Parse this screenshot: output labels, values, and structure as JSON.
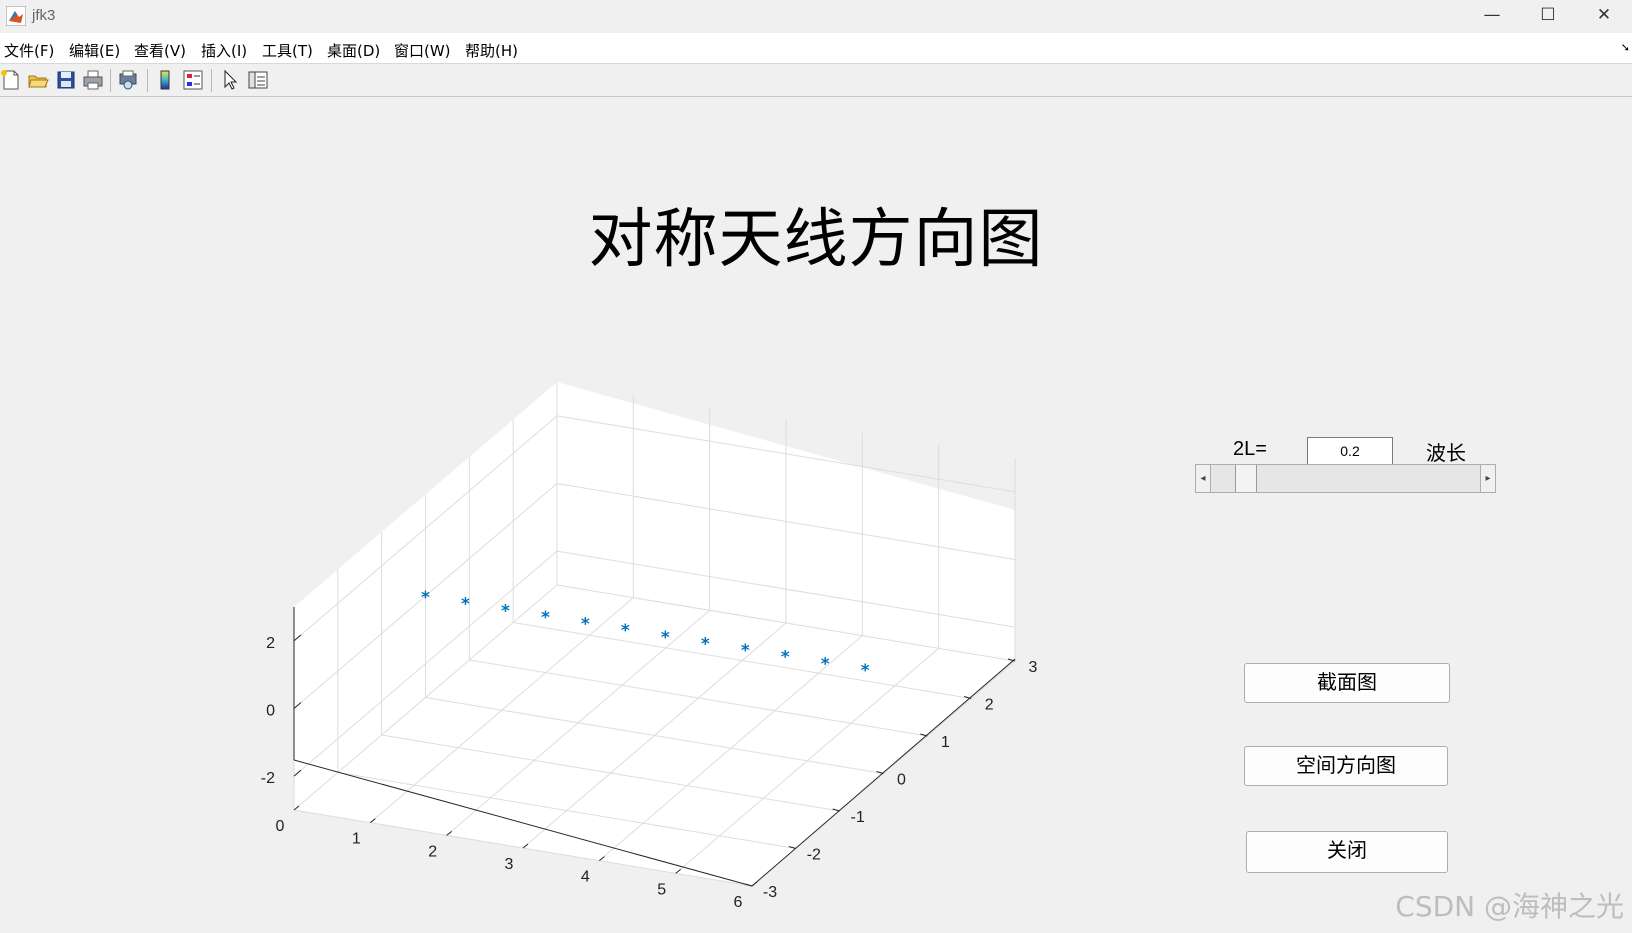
{
  "window": {
    "title": "jfk3",
    "minimize_glyph": "—",
    "maximize_glyph": "☐",
    "close_glyph": "✕"
  },
  "menu": {
    "items": [
      "文件(F)",
      "编辑(E)",
      "查看(V)",
      "插入(I)",
      "工具(T)",
      "桌面(D)",
      "窗口(W)",
      "帮助(H)"
    ]
  },
  "toolbar": {
    "icons": [
      "new-figure-icon",
      "open-file-icon",
      "save-icon",
      "print-icon",
      "print-preview-icon",
      "colorbar-icon",
      "legend-icon",
      "pointer-icon",
      "property-inspector-icon"
    ]
  },
  "figure": {
    "title": "对称天线方向图"
  },
  "controls": {
    "length_label": "2L=",
    "length_value": "0.2",
    "unit_label": "波长",
    "slider_fraction": 0.1,
    "cross_section_button": "截面图",
    "spatial_pattern_button": "空间方向图",
    "close_button": "关闭"
  },
  "watermark": "CSDN @海神之光",
  "chart_data": {
    "type": "scatter",
    "marker": "*",
    "marker_color": "#0072bd",
    "view": "3d",
    "grid": true,
    "xlim": [
      0,
      6
    ],
    "ylim": [
      -3,
      3
    ],
    "zlim": [
      -3,
      3
    ],
    "x_ticks": [
      "0",
      "1",
      "2",
      "3",
      "4",
      "5",
      "6"
    ],
    "y_ticks": [
      "-3",
      "-2",
      "-1",
      "0",
      "1",
      "2",
      "3"
    ],
    "z_ticks": [
      "-2",
      "0",
      "2"
    ],
    "points": {
      "x": [
        0,
        0.524,
        1.047,
        1.571,
        2.094,
        2.618,
        3.142,
        3.665,
        4.189,
        4.712,
        5.236,
        5.76
      ],
      "y": [
        0,
        0,
        0,
        0,
        0,
        0,
        0,
        0,
        0,
        0,
        0,
        0
      ],
      "z": [
        0,
        0,
        0,
        0,
        0,
        0,
        0,
        0,
        0,
        0,
        0,
        0
      ]
    }
  }
}
